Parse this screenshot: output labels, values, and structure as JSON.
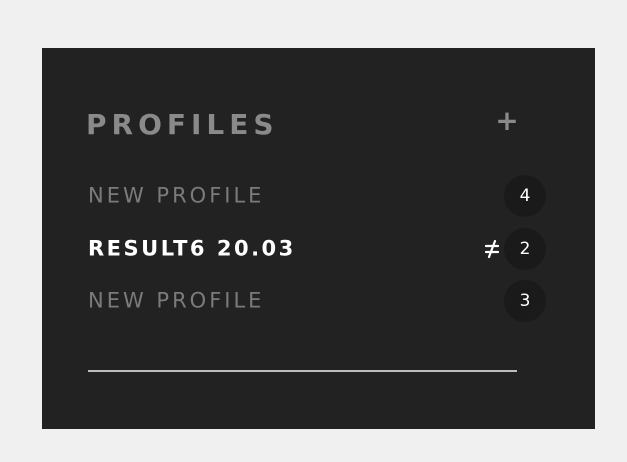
{
  "panel": {
    "title": "PROFILES",
    "add_icon": "plus-icon",
    "items": [
      {
        "label": "NEW PROFILE",
        "count": "4",
        "active": false
      },
      {
        "label": "RESULT6 20.03",
        "count": "2",
        "active": true,
        "status_icon": "not-equal-icon"
      },
      {
        "label": "NEW PROFILE",
        "count": "3",
        "active": false
      }
    ]
  },
  "colors": {
    "background": "#f0f0f0",
    "panel": "#222222",
    "muted_text": "#7b7b7b",
    "active_text": "#ffffff",
    "badge": "#1a1a1a"
  }
}
